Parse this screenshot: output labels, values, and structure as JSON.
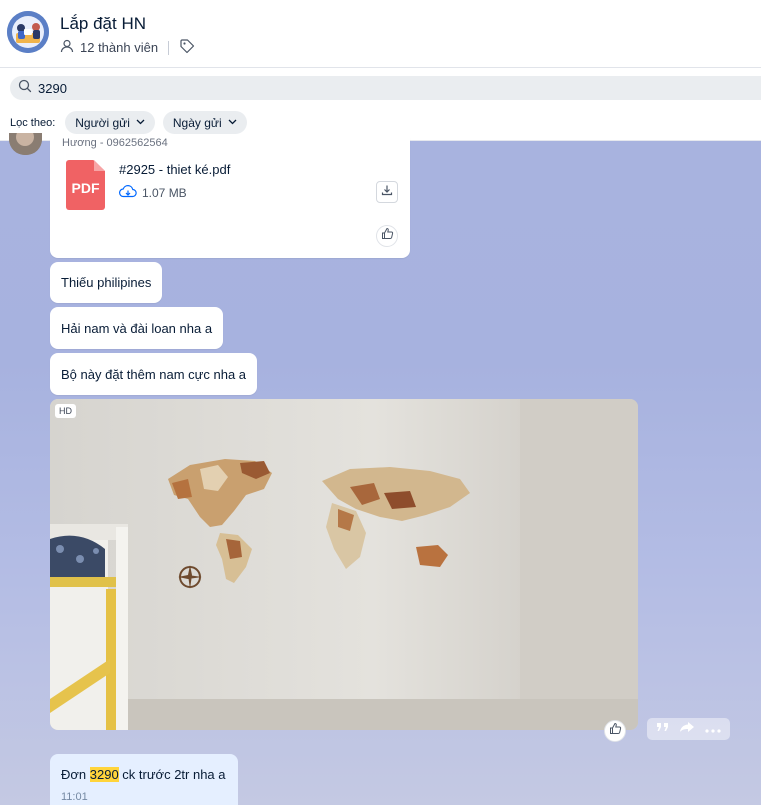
{
  "header": {
    "group_name": "Lắp đặt HN",
    "member_count": "12 thành viên",
    "icons": [
      "group-avatar",
      "person-icon",
      "tag-icon"
    ]
  },
  "search": {
    "value": "3290",
    "filter_label": "Lọc theo:",
    "filters": [
      "Người gửi",
      "Ngày gửi"
    ]
  },
  "messages": {
    "sender": "Hương - 0962562564",
    "file": {
      "name": "#2925 - thiet ké.pdf",
      "size": "1.07 MB",
      "type_label": "PDF"
    },
    "texts": [
      "Thiếu philipines",
      "Hải nam và đài loan nha a",
      "Bộ này đặt thêm nam cực nha a"
    ],
    "image_badge": "HD",
    "own_message": {
      "prefix": "Đơn ",
      "highlight": "3290",
      "suffix": " ck trước 2tr nha a",
      "time": "11:01"
    }
  },
  "colors": {
    "highlight": "#ffd43b",
    "own_bubble": "#e5efff",
    "accent": "#0068ff",
    "pdf": "#f06264"
  }
}
